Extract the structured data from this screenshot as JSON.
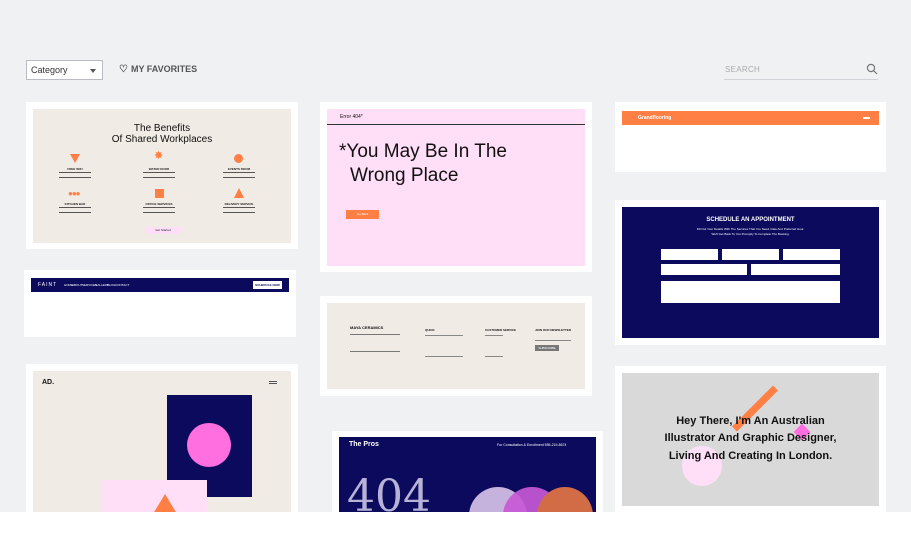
{
  "toolbar": {
    "category_label": "Category",
    "favorites_label": "MY FAVORITES",
    "search_placeholder": "SEARCH"
  },
  "colors": {
    "background": "#f0f1f3",
    "orange": "#ff7f45",
    "navy": "#0c0a5c",
    "pink": "#ffdef8",
    "beige": "#f0ebe5"
  },
  "templates": {
    "benefits": {
      "title_1": "The Benefits",
      "title_2": "Of Shared Workplaces",
      "items": [
        "FREE WIFI",
        "WATER DOOR",
        "EVENTS ROOM",
        "KITCHEN BAR",
        "OFFICE SERVICES",
        "DELIVERY SERVICE"
      ],
      "button": "Get Started"
    },
    "error404": {
      "tag": "Error 404*",
      "line1": "*You May Be In The",
      "line2": "Wrong Place",
      "button": "Go Back"
    },
    "grandflooring": {
      "brand": "Grandflooring"
    },
    "faint": {
      "logo": "FAINT",
      "nav": [
        "HOME",
        "ABOUT",
        "SERVICES",
        "GALLERY",
        "BLOG",
        "CONTACT"
      ],
      "button": "SCHEDULE NOW"
    },
    "maya": {
      "brand": "MAYA CERAMICS",
      "col1": "QUICK",
      "col2": "CUSTOMER SERVICE",
      "col3": "JOIN OUR NEWSLETTER",
      "subscribe": "SUBSCRIBE"
    },
    "appointment": {
      "title": "SCHEDULE AN APPOINTMENT",
      "sub1": "Fill Out Your Details With The Services That You Need, Date And Preferred Hour.",
      "sub2": "We'll Get Back To You Promptly To Complete The Booking."
    },
    "ad": {
      "logo": "AD."
    },
    "illustrator": {
      "line1": "Hey There, I'm An Australian",
      "line2": "Illustrator And Graphic Designer,",
      "line3": "Living And Creating In London."
    },
    "pros": {
      "brand": "The Pros",
      "contact": "For Consultation & Enrollment 555-219-8674",
      "code": "404"
    }
  }
}
